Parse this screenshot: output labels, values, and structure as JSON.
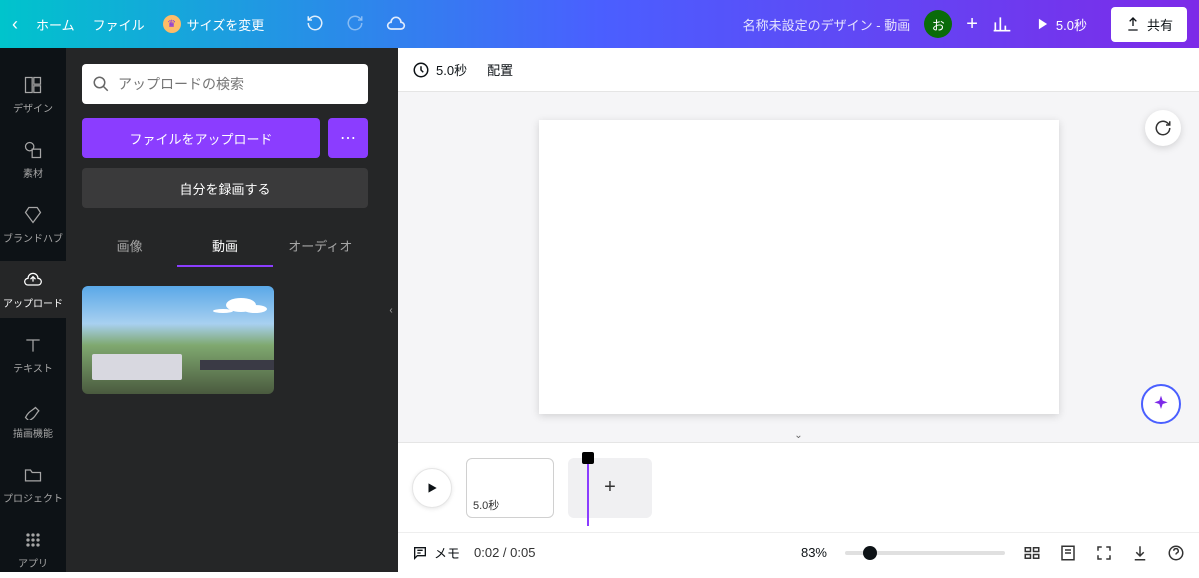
{
  "topbar": {
    "home": "ホーム",
    "file": "ファイル",
    "resize": "サイズを変更",
    "doc_title": "名称未設定のデザイン - 動画",
    "avatar_letter": "お",
    "play_duration": "5.0秒",
    "share": "共有"
  },
  "rail": {
    "items": [
      {
        "label": "デザイン"
      },
      {
        "label": "素材"
      },
      {
        "label": "ブランドハブ"
      },
      {
        "label": "アップロード"
      },
      {
        "label": "テキスト"
      },
      {
        "label": "描画機能"
      },
      {
        "label": "プロジェクト"
      },
      {
        "label": "アプリ"
      }
    ]
  },
  "panel": {
    "search_placeholder": "アップロードの検索",
    "upload_btn": "ファイルをアップロード",
    "record_btn": "自分を録画する",
    "tabs": [
      {
        "label": "画像"
      },
      {
        "label": "動画"
      },
      {
        "label": "オーディオ"
      }
    ]
  },
  "canvas": {
    "duration": "5.0秒",
    "arrange": "配置"
  },
  "timeline": {
    "clip_label": "5.0秒",
    "notes": "メモ",
    "time": "0:02 / 0:05",
    "zoom": "83%"
  }
}
